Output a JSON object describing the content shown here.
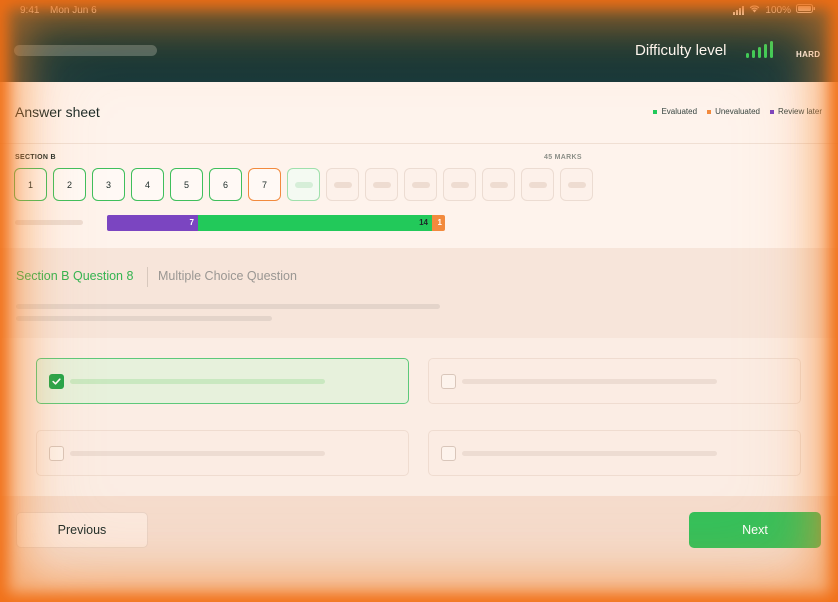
{
  "status_bar": {
    "time": "9:41",
    "date": "Mon Jun 6",
    "battery": "100%",
    "icons": [
      "cellular-signal-icon",
      "wifi-icon",
      "battery-icon"
    ]
  },
  "header": {
    "difficulty_title": "Difficulty level",
    "difficulty_value": "HARD",
    "difficulty_bars_filled": 5,
    "difficulty_bars_total": 5
  },
  "answer_sheet": {
    "title": "Answer sheet",
    "legend": [
      {
        "label": "Evaluated",
        "color": "#22c95a"
      },
      {
        "label": "Unevaluated",
        "color": "#f28a3d"
      },
      {
        "label": "Review later",
        "color": "#7b45c1"
      }
    ],
    "section_label": "SECTION B",
    "marks_label": "45 MARKS",
    "questions": [
      {
        "label": "1",
        "state": "evaluated"
      },
      {
        "label": "2",
        "state": "evaluated"
      },
      {
        "label": "3",
        "state": "evaluated"
      },
      {
        "label": "4",
        "state": "evaluated"
      },
      {
        "label": "5",
        "state": "evaluated"
      },
      {
        "label": "6",
        "state": "evaluated"
      },
      {
        "label": "7",
        "state": "unevaluated"
      },
      {
        "label": "",
        "state": "current"
      },
      {
        "label": "",
        "state": "empty"
      },
      {
        "label": "",
        "state": "empty"
      },
      {
        "label": "",
        "state": "empty"
      },
      {
        "label": "",
        "state": "empty"
      },
      {
        "label": "",
        "state": "empty"
      },
      {
        "label": "",
        "state": "empty"
      },
      {
        "label": "",
        "state": "empty"
      }
    ],
    "progress": {
      "review_later": "7",
      "evaluated": "14",
      "unevaluated": "1"
    }
  },
  "question": {
    "title": "Section B Question 8",
    "type": "Multiple Choice Question",
    "options": [
      {
        "selected": true
      },
      {
        "selected": false
      },
      {
        "selected": false
      },
      {
        "selected": false
      }
    ]
  },
  "footer": {
    "previous_label": "Previous",
    "next_label": "Next"
  },
  "colors": {
    "accent_green": "#34c05a",
    "header_bg": "#14342f",
    "review_purple": "#7b45c1",
    "unevaluated_orange": "#f28a3d"
  }
}
